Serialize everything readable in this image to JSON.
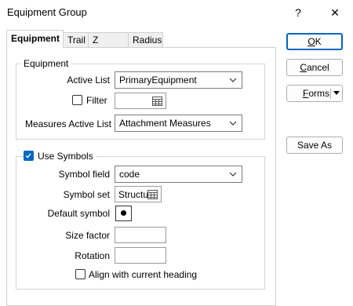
{
  "window": {
    "title": "Equipment Group",
    "help_glyph": "?",
    "close_glyph": "✕"
  },
  "tabs": [
    {
      "label": "Equipment",
      "active": true
    },
    {
      "label": "Trail",
      "active": false
    },
    {
      "label": "Z Values",
      "active": false
    },
    {
      "label": "Radius",
      "active": false
    }
  ],
  "equipment_group": {
    "label": "Equipment",
    "active_list": {
      "label": "Active List",
      "value": "PrimaryEquipment"
    },
    "filter": {
      "label": "Filter",
      "checked": false,
      "value": ""
    },
    "measures_active_list": {
      "label": "Measures Active List",
      "value": "Attachment Measures"
    }
  },
  "symbols_group": {
    "label": "Use Symbols",
    "checked": true,
    "symbol_field": {
      "label": "Symbol field",
      "value": "code"
    },
    "symbol_set": {
      "label": "Symbol set",
      "value": "Structu"
    },
    "default_symbol": {
      "label": "Default symbol"
    },
    "size_factor": {
      "label": "Size factor",
      "value": ""
    },
    "rotation": {
      "label": "Rotation",
      "value": ""
    },
    "align_heading": {
      "label": "Align with current heading",
      "checked": false
    }
  },
  "buttons": {
    "ok_first": "O",
    "ok_rest": "K",
    "cancel_first": "C",
    "cancel_rest": "ancel",
    "forms_first": "F",
    "forms_rest": "orms",
    "save_as": "Save As"
  },
  "colors": {
    "accent": "#0067c0"
  }
}
